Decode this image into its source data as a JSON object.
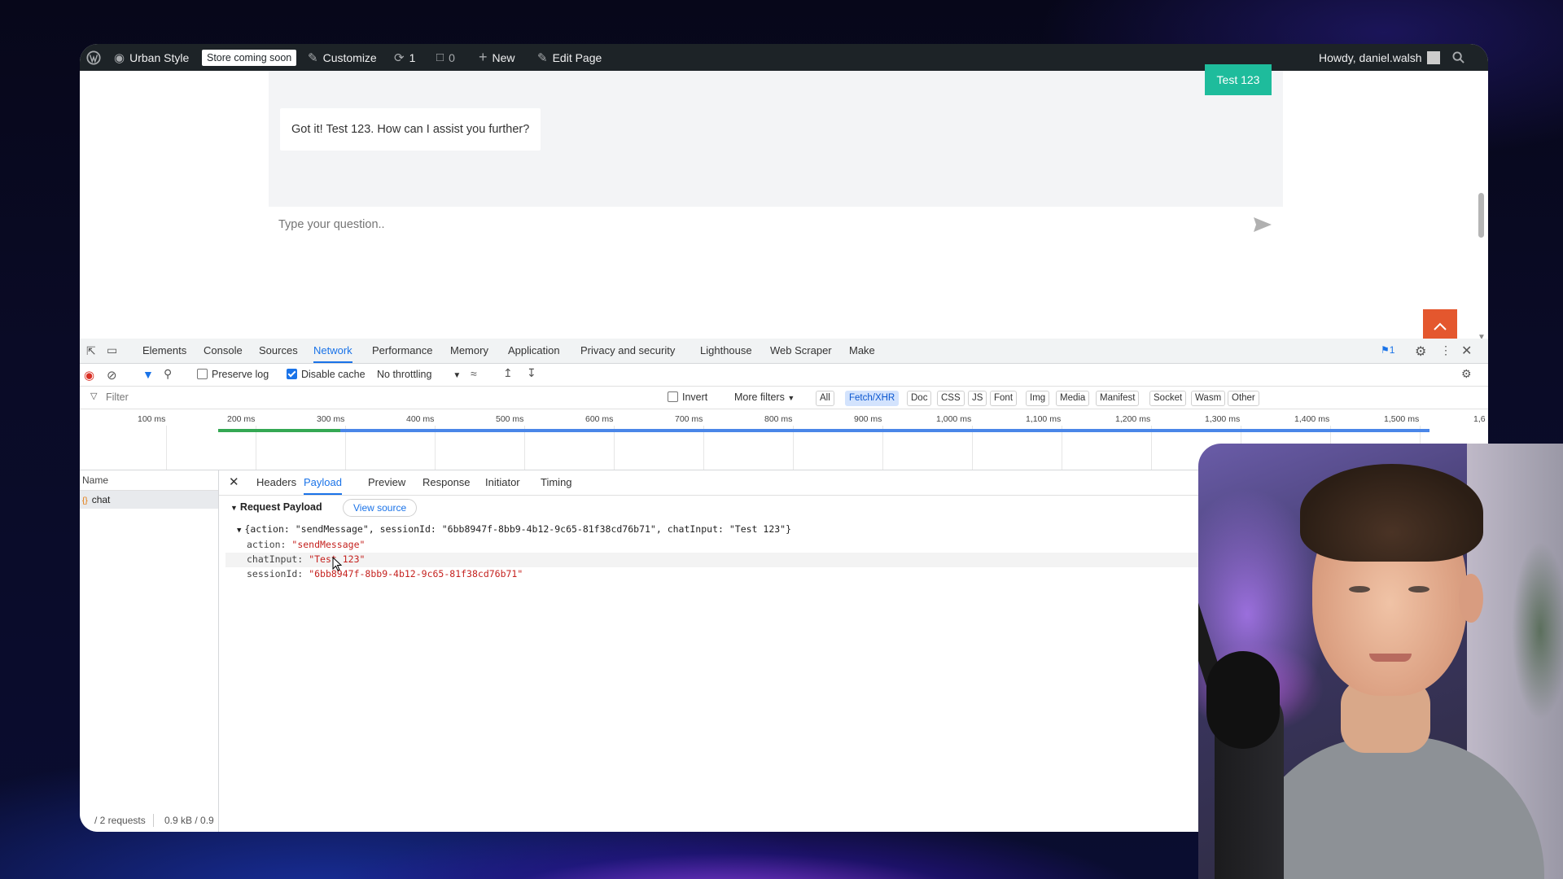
{
  "admin_bar": {
    "site_name": "Urban Style",
    "store_badge": "Store coming soon",
    "customize": "Customize",
    "updates_count": "1",
    "comments_count": "0",
    "new_label": "New",
    "edit_page": "Edit Page",
    "howdy": "Howdy, daniel.walsh"
  },
  "chat": {
    "user_message": "Test 123",
    "bot_message": "Got it! Test 123. How can I assist you further?",
    "input_placeholder": "Type your question.."
  },
  "devtools": {
    "tabs": [
      "Elements",
      "Console",
      "Sources",
      "Network",
      "Performance",
      "Memory",
      "Application",
      "Privacy and security",
      "Lighthouse",
      "Web Scraper",
      "Make"
    ],
    "active_tab": "Network",
    "issues_count": "1",
    "toolbar": {
      "preserve_log": "Preserve log",
      "disable_cache": "Disable cache",
      "throttling": "No throttling"
    },
    "filter": {
      "placeholder": "Filter",
      "invert": "Invert",
      "more_filters": "More filters",
      "types": [
        "All",
        "Fetch/XHR",
        "Doc",
        "CSS",
        "JS",
        "Font",
        "Img",
        "Media",
        "Manifest",
        "Socket",
        "Wasm",
        "Other"
      ],
      "active_type": "Fetch/XHR"
    },
    "timeline_ticks": [
      "100 ms",
      "200 ms",
      "300 ms",
      "400 ms",
      "500 ms",
      "600 ms",
      "700 ms",
      "800 ms",
      "900 ms",
      "1,000 ms",
      "1,100 ms",
      "1,200 ms",
      "1,300 ms",
      "1,400 ms",
      "1,500 ms",
      "1,6"
    ],
    "name_header": "Name",
    "requests": [
      "chat"
    ],
    "detail_tabs": [
      "Headers",
      "Payload",
      "Preview",
      "Response",
      "Initiator",
      "Timing"
    ],
    "active_detail_tab": "Payload",
    "payload": {
      "section_title": "Request Payload",
      "view_source": "View source",
      "summary": "{action: \"sendMessage\", sessionId: \"6bb8947f-8bb9-4b12-9c65-81f38cd76b71\", chatInput: \"Test 123\"}",
      "fields": [
        {
          "key": "action:",
          "value": "\"sendMessage\""
        },
        {
          "key": "chatInput:",
          "value": "\"Test 123\""
        },
        {
          "key": "sessionId:",
          "value": "\"6bb8947f-8bb9-4b12-9c65-81f38cd76b71\""
        }
      ]
    },
    "status": {
      "requests": "/ 2 requests",
      "transferred": "0.9 kB / 0.9"
    }
  }
}
